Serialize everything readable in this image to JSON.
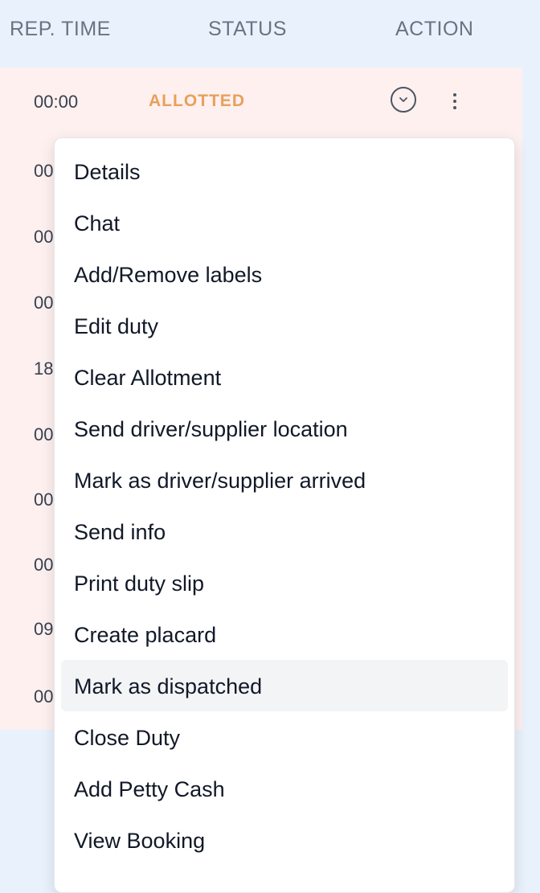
{
  "table": {
    "columns": [
      "REP. TIME",
      "STATUS",
      "ACTION"
    ],
    "rows": [
      {
        "rep_time": "00:00",
        "status": "ALLOTTED"
      },
      {
        "rep_time": "00"
      },
      {
        "rep_time": "00"
      },
      {
        "rep_time": "00"
      },
      {
        "rep_time": "18"
      },
      {
        "rep_time": "00"
      },
      {
        "rep_time": "00"
      },
      {
        "rep_time": "00"
      },
      {
        "rep_time": "09"
      },
      {
        "rep_time": "00"
      }
    ]
  },
  "menu": {
    "items": [
      "Details",
      "Chat",
      "Add/Remove labels",
      "Edit duty",
      "Clear Allotment",
      "Send driver/supplier location",
      "Mark as driver/supplier arrived",
      "Send info",
      "Print duty slip",
      "Create placard",
      "Mark as dispatched",
      "Close Duty",
      "Add Petty Cash",
      "View Booking"
    ],
    "highlighted": "Mark as dispatched"
  },
  "icons": {
    "expand": "chevron-down-icon",
    "more": "kebab-menu-icon"
  },
  "colors": {
    "header_bg": "#e9f2fc",
    "row_bg": "#fdf0ef",
    "status_allotted": "#e8a05a",
    "menu_hover": "#f3f4f6"
  }
}
